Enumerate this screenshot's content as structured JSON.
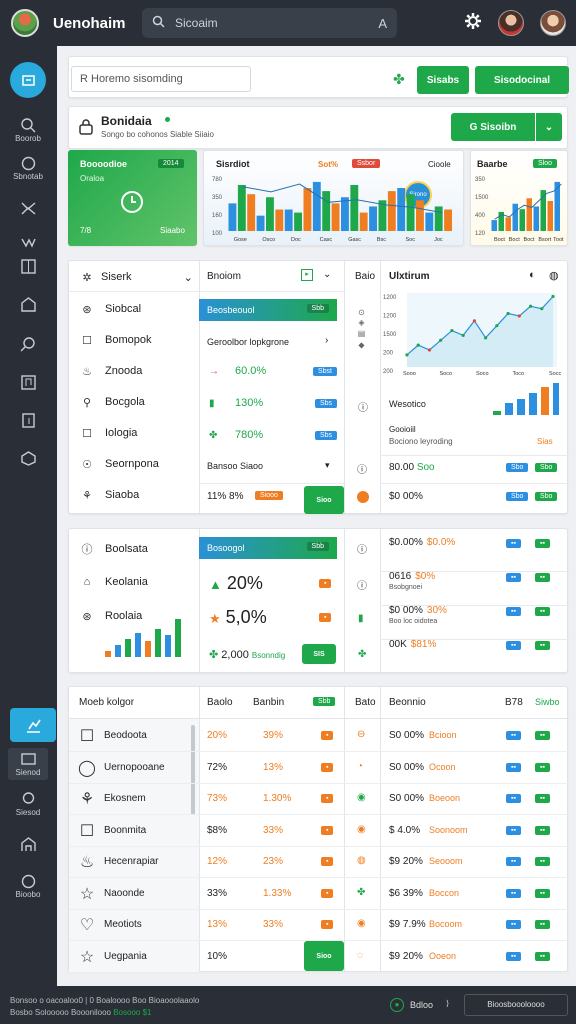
{
  "header": {
    "app_name": "Uenohaim",
    "search_placeholder": "Sicoaim",
    "search_key": "A"
  },
  "toolbar": {
    "filter_placeholder": "R Horemo sisomding",
    "btn1": "Sisabs",
    "btn2": "Sisodocinal"
  },
  "profile": {
    "title": "Bonidaia",
    "subtitle": "Songo bo cohonos Siable Siiaio",
    "action": "G Sisoibn"
  },
  "summary": {
    "card1_title": "Boooodioe",
    "card1_sub": "Oraloa",
    "card1_badge": "2014",
    "card1_left": "7/8",
    "card1_right": "Siaabo",
    "card2_title": "Sisrdiot",
    "card2_val": "Sot%",
    "card2_badge": "Ssbor",
    "card2_menu": "Cioole",
    "card2_gauge": "Sirono",
    "card3_title": "Baarbe",
    "card3_badge": "Sloo"
  },
  "chart_data": [
    {
      "type": "bar",
      "categories": [
        "Gose",
        "Osco",
        "Doc",
        "Casc",
        "Gasc",
        "Bsc",
        "Soc",
        "Joc"
      ],
      "series": [
        {
          "values": [
            18,
            10,
            14,
            32,
            22,
            16,
            28,
            12
          ]
        },
        {
          "values": [
            30,
            22,
            12,
            26,
            30,
            20,
            24,
            16
          ]
        },
        {
          "values": [
            24,
            14,
            28,
            18,
            12,
            26,
            20,
            14
          ]
        }
      ],
      "overlay_line": [
        34,
        30,
        36,
        22,
        24,
        20,
        18,
        14
      ],
      "ylabels": [
        "780",
        "350",
        "160",
        "100"
      ]
    },
    {
      "type": "bar",
      "categories": [
        "Boct",
        "Boct",
        "Boct",
        "Bsort",
        "Toot"
      ],
      "values": [
        8,
        14,
        10,
        20,
        16,
        24,
        18,
        30,
        22,
        36
      ],
      "overlay_line": [
        10,
        14,
        12,
        18,
        22,
        20,
        26,
        32,
        34,
        40
      ],
      "ylabels": [
        "350",
        "1500",
        "400",
        "120"
      ]
    },
    {
      "type": "line",
      "x": [
        "Sooo",
        "Soco",
        "Soco",
        "Toco",
        "Socc"
      ],
      "values": [
        10,
        18,
        14,
        22,
        30,
        26,
        38,
        24,
        34,
        44,
        42,
        50,
        48,
        58
      ],
      "ylabels": [
        "1200",
        "1200",
        "1500",
        "200",
        "200"
      ]
    }
  ],
  "filter_panel": {
    "title": "Siserk",
    "items": [
      "Siobcal",
      "Bomopok",
      "Znooda",
      "Bocgola",
      "Iologia",
      "Seornpona",
      "Siaoba"
    ]
  },
  "detail_panel": {
    "header": "Bnoiom",
    "highlight": "Beosbeouol",
    "highlight_tag": "Sbb",
    "dropdown": "Geroolbor lopkgrone",
    "rows": [
      {
        "val": "60.0%",
        "tag": "Sbst"
      },
      {
        "val": "130%",
        "tag": "Sbs"
      },
      {
        "val": "780%",
        "tag": "Sbs"
      }
    ],
    "select": "Bansoo Siaoo",
    "footer_left": "11% 8%",
    "footer_tag": "Siooo",
    "footer_btn": "Sioo"
  },
  "metrics_panel": {
    "col_title": "Baio",
    "title": "Ulxtirum",
    "sub1": "Wesotico",
    "sub2": "Gooioiil",
    "sub3": "Bociono leyroding",
    "sub_tag": "Sias",
    "rows": [
      {
        "a": "80.00",
        "b": "Soo"
      },
      {
        "a": "$0 00%",
        "b": ""
      }
    ],
    "tags": [
      "Sbo",
      "Sbo"
    ]
  },
  "panel2": {
    "items": [
      "Boolsata",
      "Keolania",
      "Roolaia"
    ],
    "bar": "Bosoogol",
    "bar_tag": "Sbb",
    "big1": "20%",
    "big2": "5,0%",
    "small": "2,000",
    "small_label": "Bsonndig",
    "small_btn": "SIS",
    "right": [
      {
        "a": "$0.00%",
        "b": "$0.0%"
      },
      {
        "a": "0616",
        "b": "$0%",
        "sub": "Bsobgnoei"
      },
      {
        "a": "$0 00%",
        "b": "30%",
        "sub": "Boo loc oidotea"
      },
      {
        "a": "00K",
        "b": "$81%"
      }
    ]
  },
  "table": {
    "head": [
      "Moeb kolgor",
      "Baolo",
      "Banbin",
      "Bato",
      "Beonnio"
    ],
    "head_btn": "Sbb",
    "head_r1": "B78",
    "head_r2": "Siwbo",
    "rows": [
      {
        "name": "Beodoota",
        "c1": "20%",
        "c2": "39%",
        "c3": "",
        "r": "S0 00%",
        "rl": "Bcioon"
      },
      {
        "name": "Uernopooane",
        "c1": "72%",
        "c2": "13%",
        "c3": "",
        "r": "S0 00%",
        "rl": "Ocoon"
      },
      {
        "name": "Ekosnem",
        "c1": "73%",
        "c2": "1.30%",
        "c3": "",
        "r": "S0 00%",
        "rl": "Boeoon"
      },
      {
        "name": "Boonmita",
        "c1": "$8%",
        "c2": "33%",
        "c3": "",
        "r": "$ 4.0%",
        "rl": "Soonoom"
      },
      {
        "name": "Hecenrapiar",
        "c1": "12%",
        "c2": "23%",
        "c3": "",
        "r": "$9 20%",
        "rl": "Seooom"
      },
      {
        "name": "Naoonde",
        "c1": "33%",
        "c2": "1.33%",
        "c3": "",
        "r": "$6 39%",
        "rl": "Boccon"
      },
      {
        "name": "Meotiots",
        "c1": "13%",
        "c2": "33%",
        "c3": "",
        "r": "$9 7.9%",
        "rl": "Bocoom"
      },
      {
        "name": "Uegpania",
        "c1": "10%",
        "c2": "",
        "c3": "",
        "r": "$9 20%",
        "rl": "Ooeon"
      }
    ],
    "foot_btn": "Sioo"
  },
  "sidebar": {
    "items": [
      "Boorob",
      "Sbnotab",
      "",
      "",
      "",
      "",
      "",
      "",
      "",
      "Sienod",
      "Siesod",
      "Bioobo"
    ]
  },
  "footer": {
    "left1": "Bonsoo o oacoaloo0 | 0 Boaloooo Boo Bioaooolaaolo",
    "left2": "Bosbo Solooooo Booonilooo",
    "left3": "Bosooo $1",
    "right_label": "Bdloo",
    "right_btn": "Bioosboooloooo"
  }
}
